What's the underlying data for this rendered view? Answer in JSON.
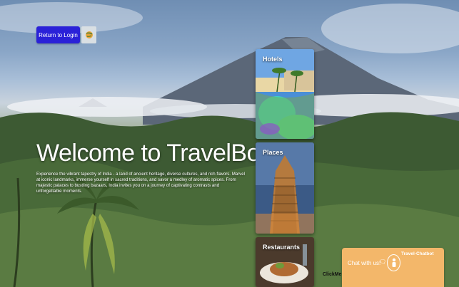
{
  "header": {
    "login_button": "Return to Login"
  },
  "hero": {
    "title": "Welcome to TravelBot",
    "intro": "Experience the vibrant tapestry of India - a land of ancient heritage, diverse cultures, and rich flavors. Marvel at iconic landmarks, immerse yourself in sacred traditions, and savor a medley of aromatic spices. From majestic palaces to bustling bazaars, India invites you on a journey of captivating contrasts and unforgettable moments."
  },
  "cards": {
    "hotels": "Hotels",
    "places": "Places",
    "restaurants": "Restaurants"
  },
  "chat": {
    "clickme": "ClickMe",
    "title": "Travel-Chatbot",
    "prompt": "Chat with us!",
    "icon": "chat-bubble-icon"
  },
  "colors": {
    "login_button": "#2a21d8",
    "chat_widget": "#f3b76a"
  }
}
